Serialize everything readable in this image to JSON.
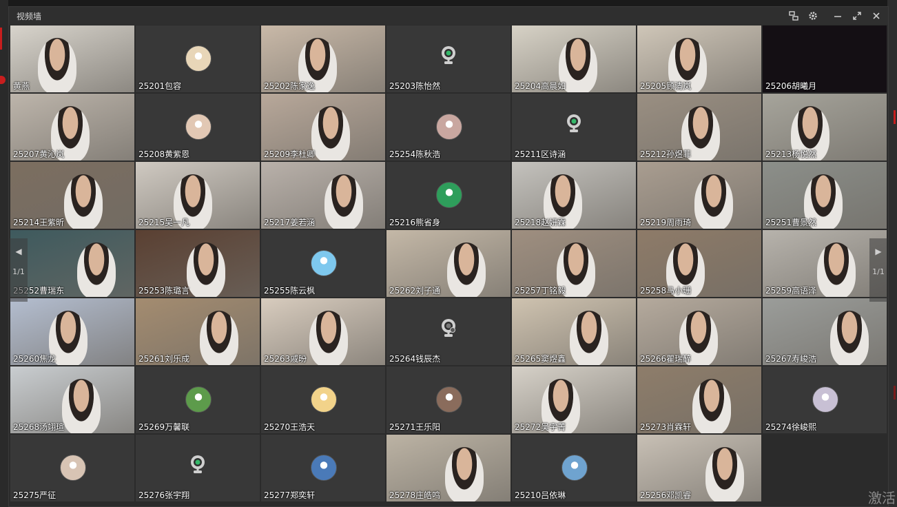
{
  "window": {
    "title": "视频墙"
  },
  "toolbar": {
    "icons": [
      "switch-view-icon",
      "gear-icon",
      "minimize-icon",
      "maximize-icon",
      "close-icon"
    ]
  },
  "pager": {
    "left_count": "1/1",
    "right_count": "1/1"
  },
  "watermark": {
    "text": "激活"
  },
  "participants": [
    {
      "name": "黄燕",
      "type": "video",
      "scene": "#d8d4cc"
    },
    {
      "name": "25201包容",
      "type": "avatar",
      "avatar_color": "#e8d6b8"
    },
    {
      "name": "25202陈家逸",
      "type": "video",
      "scene": "#c9b9a8"
    },
    {
      "name": "25203陈怡然",
      "type": "camera"
    },
    {
      "name": "25204高晨如",
      "type": "video",
      "scene": "#d7d2c6"
    },
    {
      "name": "25205顾清岚",
      "type": "video",
      "scene": "#cfc6b8"
    },
    {
      "name": "25206胡曦月",
      "type": "dark"
    },
    {
      "name": "25207黄沁岚",
      "type": "video",
      "scene": "#bdb5ab"
    },
    {
      "name": "25208黄紫恩",
      "type": "avatar",
      "avatar_color": "#e2c8b4"
    },
    {
      "name": "25209李杜卿",
      "type": "video",
      "scene": "#b8a89a"
    },
    {
      "name": "25254陈秋浩",
      "type": "avatar",
      "avatar_color": "#c9a7a0"
    },
    {
      "name": "25211区诗涵",
      "type": "camera"
    },
    {
      "name": "25212孙煜菲",
      "type": "video",
      "scene": "#9a8f82"
    },
    {
      "name": "25213杨悦然",
      "type": "video",
      "scene": "#a6a49b"
    },
    {
      "name": "25214王紫昕",
      "type": "video",
      "scene": "#7c6e60"
    },
    {
      "name": "25215吴一凡",
      "type": "video",
      "scene": "#cfc9c1"
    },
    {
      "name": "25217姜若涵",
      "type": "video",
      "scene": "#b9b1aa"
    },
    {
      "name": "25216熊省身",
      "type": "avatar",
      "avatar_color": "#2e9e5b"
    },
    {
      "name": "25218赵妍霖",
      "type": "video",
      "scene": "#c4c2bd"
    },
    {
      "name": "25219周雨琦",
      "type": "video",
      "scene": "#a99d90"
    },
    {
      "name": "25251曹景然",
      "type": "video",
      "scene": "#8c8f8a"
    },
    {
      "name": "25252曹瑞东",
      "type": "video",
      "scene": "#3e5a5e"
    },
    {
      "name": "25253陈璐言",
      "type": "video",
      "scene": "#5a4032"
    },
    {
      "name": "25255陈云枫",
      "type": "avatar",
      "avatar_color": "#7ec8ee"
    },
    {
      "name": "25262刘子通",
      "type": "video",
      "scene": "#c4b8a7"
    },
    {
      "name": "25257丁铭毅",
      "type": "video",
      "scene": "#9f8f80"
    },
    {
      "name": "25258马小珊",
      "type": "video",
      "scene": "#8e7b68"
    },
    {
      "name": "25259高语泽",
      "type": "video",
      "scene": "#b7b3ac"
    },
    {
      "name": "25260焦龙",
      "type": "video",
      "scene": "#b4bed0"
    },
    {
      "name": "25261刘乐成",
      "type": "video",
      "scene": "#a48c70"
    },
    {
      "name": "25263戚昐",
      "type": "video",
      "scene": "#d8ccbe"
    },
    {
      "name": "25264钱辰杰",
      "type": "camera-off"
    },
    {
      "name": "25265窦煜鑫",
      "type": "video",
      "scene": "#cfc3b0"
    },
    {
      "name": "25266瞿瑞醉",
      "type": "video",
      "scene": "#b5aa9d"
    },
    {
      "name": "25267寿峻浩",
      "type": "video",
      "scene": "#9b9d9a"
    },
    {
      "name": "25268汤翊瑄",
      "type": "video",
      "scene": "#c9cdd0"
    },
    {
      "name": "25269万馨联",
      "type": "avatar",
      "avatar_color": "#5d9b4b"
    },
    {
      "name": "25270王浩天",
      "type": "avatar",
      "avatar_color": "#f2d38a"
    },
    {
      "name": "25271王乐阳",
      "type": "avatar",
      "avatar_color": "#8a6c5c"
    },
    {
      "name": "25272吴宇菁",
      "type": "video",
      "scene": "#d6d1c8"
    },
    {
      "name": "25273肖霖轩",
      "type": "video",
      "scene": "#8e7d6a"
    },
    {
      "name": "25274徐峻熙",
      "type": "avatar",
      "avatar_color": "#c8c0d4"
    },
    {
      "name": "25275严征",
      "type": "avatar",
      "avatar_color": "#d8c4b4"
    },
    {
      "name": "25276张宇翔",
      "type": "camera"
    },
    {
      "name": "25277郑奕轩",
      "type": "avatar",
      "avatar_color": "#4a7ab8"
    },
    {
      "name": "25278庄皓鸣",
      "type": "video",
      "scene": "#bcb3a4"
    },
    {
      "name": "25210吕依琳",
      "type": "avatar",
      "avatar_color": "#6fa3cf"
    },
    {
      "name": "25256邓凯睿",
      "type": "video",
      "scene": "#c8c0b5"
    }
  ]
}
